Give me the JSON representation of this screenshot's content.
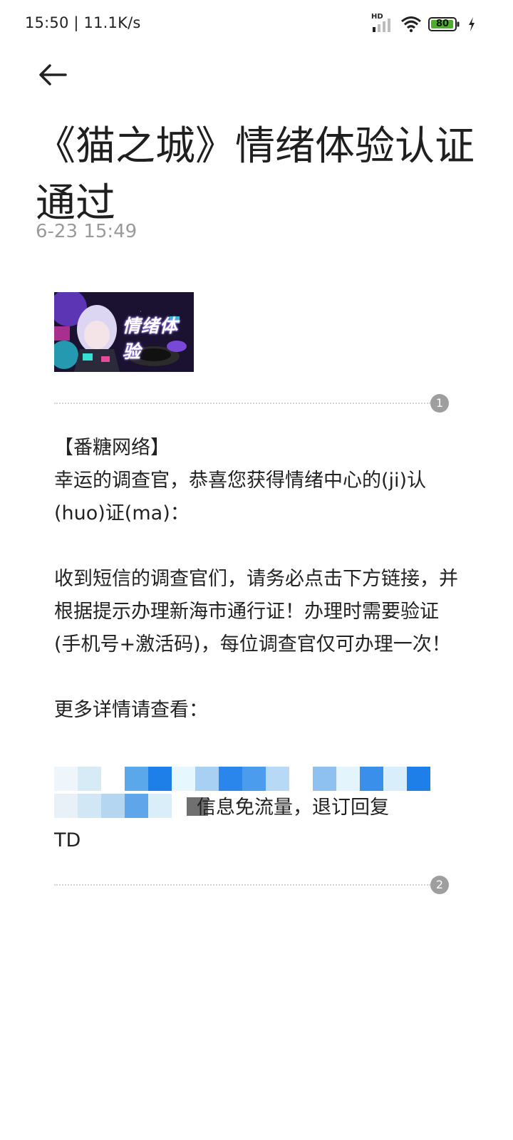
{
  "status_bar": {
    "time_speed": "15:50 | 11.1K/s",
    "hd_label": "HD",
    "battery": "80",
    "icons": [
      "signal-icon",
      "wifi-icon",
      "battery-icon",
      "charging-icon"
    ]
  },
  "header": {
    "back_icon": "arrow-left-icon",
    "title": "《猫之城》情绪体验认证通过",
    "timestamp": "6-23 15:49"
  },
  "banner": {
    "text": "情绪体验"
  },
  "dividers": [
    {
      "badge": "1"
    },
    {
      "badge": "2"
    }
  ],
  "message": {
    "body": "【番糖网络】\n幸运的调查官，恭喜您获得情绪中心的(ji)认(huo)证(ma)：\n\n收到短信的调查官们，请务必点击下方链接，并根据提示办理新海市通行证！办理时需要验证(手机号+激活码)，每位调查官仅可办理一次！\n\n更多详情请查看：",
    "tail_line1": "信息免流量，退订回复",
    "tail_line2": "TD"
  },
  "colors": {
    "accent_blue": "#1e7fe8",
    "badge_gray": "#9e9e9e",
    "battery_green": "#4caf2a"
  }
}
